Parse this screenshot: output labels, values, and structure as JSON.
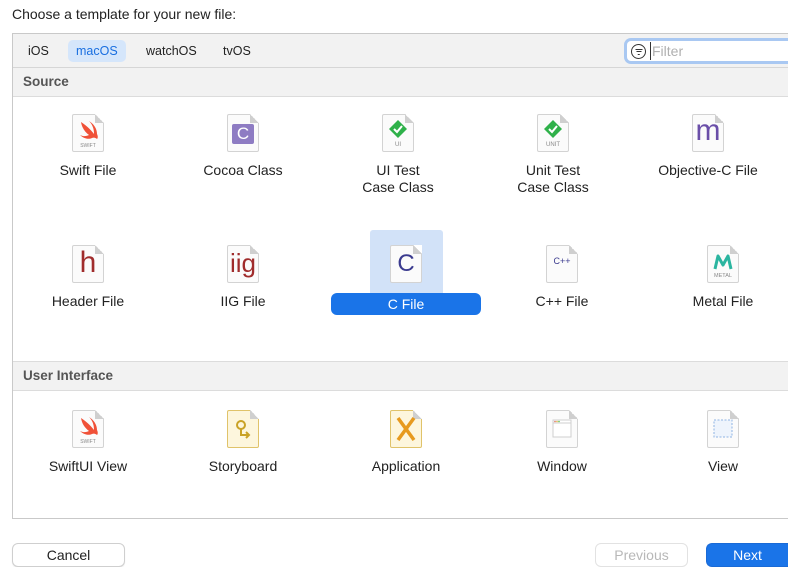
{
  "heading": "Choose a template for your new file:",
  "platforms": [
    "iOS",
    "macOS",
    "watchOS",
    "tvOS"
  ],
  "selected_platform": "macOS",
  "filter": {
    "placeholder": "Filter",
    "icon": "filter-icon"
  },
  "sections": {
    "source": {
      "title": "Source",
      "items": [
        {
          "label_lines": [
            "Swift File"
          ],
          "icon": "swift-file-icon",
          "icon_text": "SWIFT"
        },
        {
          "label_lines": [
            "Cocoa Class"
          ],
          "icon": "cocoa-class-icon",
          "icon_text": "C"
        },
        {
          "label_lines": [
            "UI Test",
            "Case Class"
          ],
          "icon": "ui-test-icon",
          "icon_text": "UI"
        },
        {
          "label_lines": [
            "Unit Test",
            "Case Class"
          ],
          "icon": "unit-test-icon",
          "icon_text": "UNIT"
        },
        {
          "label_lines": [
            "Objective-C File"
          ],
          "icon": "objective-c-file-icon",
          "icon_text": "m"
        },
        {
          "label_lines": [
            "Header File"
          ],
          "icon": "header-file-icon",
          "icon_text": "h"
        },
        {
          "label_lines": [
            "IIG File"
          ],
          "icon": "iig-file-icon",
          "icon_text": "iig"
        },
        {
          "label_lines": [
            "C File"
          ],
          "icon": "c-file-icon",
          "icon_text": "C",
          "selected": true
        },
        {
          "label_lines": [
            "C++ File"
          ],
          "icon": "cpp-file-icon",
          "icon_text": "C++"
        },
        {
          "label_lines": [
            "Metal File"
          ],
          "icon": "metal-file-icon",
          "icon_text": "METAL"
        }
      ]
    },
    "user_interface": {
      "title": "User Interface",
      "items": [
        {
          "label_lines": [
            "SwiftUI View"
          ],
          "icon": "swiftui-view-icon",
          "icon_text": "SWIFT"
        },
        {
          "label_lines": [
            "Storyboard"
          ],
          "icon": "storyboard-icon"
        },
        {
          "label_lines": [
            "Application"
          ],
          "icon": "application-icon"
        },
        {
          "label_lines": [
            "Window"
          ],
          "icon": "window-icon"
        },
        {
          "label_lines": [
            "View"
          ],
          "icon": "view-icon"
        }
      ]
    }
  },
  "buttons": {
    "cancel": "Cancel",
    "previous": "Previous",
    "next": "Next"
  },
  "colors": {
    "accent": "#1a74e8",
    "selection": "#d2e2f8",
    "swift": "#f05138",
    "check": "#2fb14a",
    "cocoa": "#8e7cc3",
    "red_letter": "#a02c2c"
  }
}
